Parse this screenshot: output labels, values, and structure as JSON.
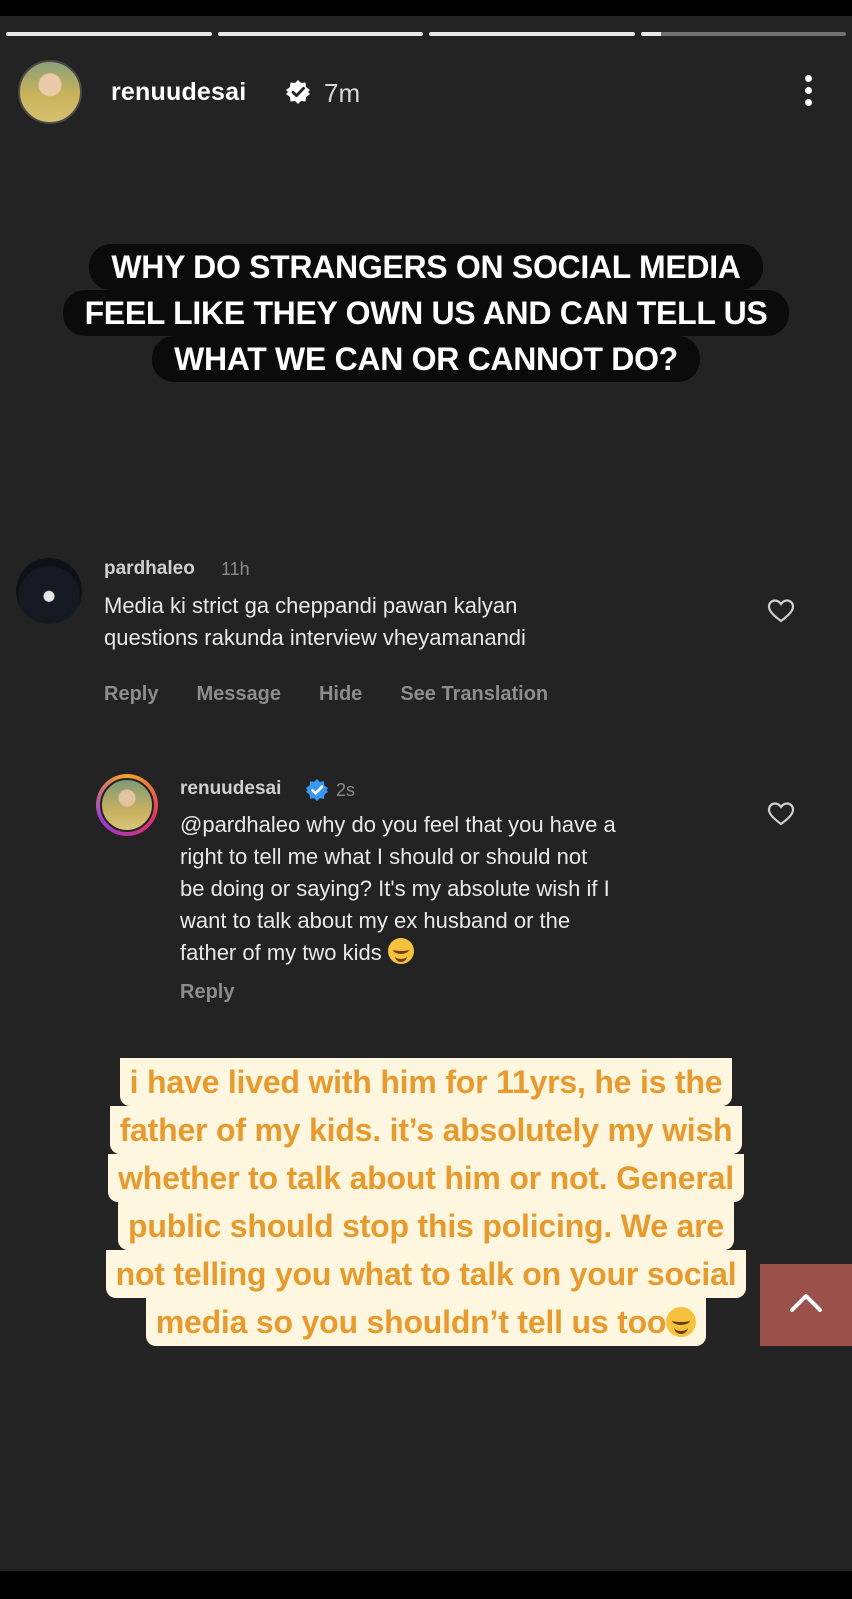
{
  "header": {
    "username": "renuudesai",
    "time": "7m",
    "verified_icon": "verified-badge-icon",
    "more_icon": "more-vertical-icon"
  },
  "progress": {
    "segments": 4,
    "active_segment": 4,
    "active_fill": 0.1
  },
  "headline": {
    "lines": [
      "WHY DO STRANGERS ON SOCIAL MEDIA",
      "FEEL LIKE THEY OWN US AND CAN TELL US",
      "WHAT WE CAN OR CANNOT DO?"
    ]
  },
  "comment": {
    "username": "pardhaleo",
    "time": "11h",
    "text_lines": [
      "Media ki strict ga cheppandi pawan kalyan",
      "questions rakunda interview vheyamanandi"
    ],
    "actions": {
      "reply": "Reply",
      "message": "Message",
      "hide": "Hide",
      "translate": "See Translation"
    }
  },
  "reply": {
    "username": "renuudesai",
    "time": "2s",
    "text_lines": [
      "@pardhaleo why do you feel that you have a",
      "right to tell me what I should or should not",
      "be doing or saying? It's my absolute wish if I",
      "want to talk about my ex husband or the",
      "father of my two kids"
    ],
    "reply_label": "Reply"
  },
  "sticker": {
    "lines": [
      "i have lived with him for 11yrs, he is the",
      "father of my kids. it’s absolutely my wish",
      "whether to talk about him or not. General",
      "public should stop this policing. We are",
      "not telling you what to talk on your social",
      "media so you shouldn’t tell us too"
    ]
  },
  "colors": {
    "background": "#232323",
    "sticker_bg": "#fff6df",
    "sticker_text": "#e79a2d",
    "verified_blue": "#3897f0"
  }
}
